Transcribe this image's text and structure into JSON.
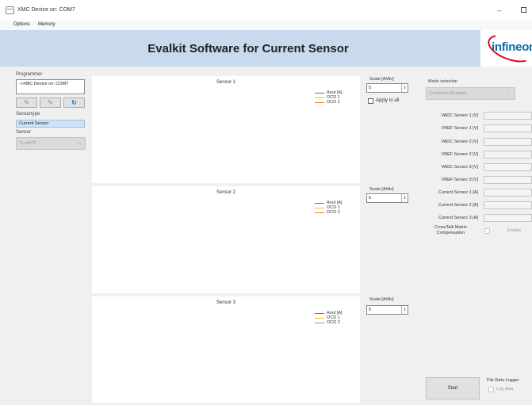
{
  "window": {
    "title": "XMC Device on: COM7",
    "minimize_glyph": "–"
  },
  "menu": {
    "items": [
      "Options",
      "Memory"
    ]
  },
  "banner": {
    "title": "Evalkit Software for Current Sensor",
    "logo_text": "infineon"
  },
  "sidebar": {
    "programmer_label": "Programmer",
    "programmer_value": "->XMC Device on: COM7",
    "tools": {
      "pencil": "✎",
      "pencil_disabled": "✎",
      "refresh": "↻"
    },
    "sensortype_label": "Sensortype",
    "sensortype_item": "Current Sensor",
    "sensor_label": "Sensor",
    "sensor_value": "TLx4973",
    "chevron": "⌄"
  },
  "charts": [
    {
      "title": "Sensor 1",
      "legend": [
        "Aout [A]",
        "OCD 1",
        "OCD 2"
      ]
    },
    {
      "title": "Sensor 2",
      "legend": [
        "Aout [A]",
        "OCD 1",
        "OCD 2"
      ]
    },
    {
      "title": "Sensor 3",
      "legend": [
        "Aout [A]",
        "OCD 1",
        "OCD 2"
      ]
    }
  ],
  "legend_colors": [
    "#4472c4",
    "#ffc000",
    "#ed7d31"
  ],
  "scales": [
    {
      "label": "Scale [A/div]",
      "value": "5"
    },
    {
      "label": "Scale [A/div]",
      "value": "5"
    },
    {
      "label": "Scale [A/div]",
      "value": "5"
    }
  ],
  "spin_glyph": "⇕",
  "apply_to_all": "Apply to all",
  "right_panel": {
    "mode_label": "Mode selection",
    "mode_value": "Continuos Readout",
    "measurements": [
      "VADC Sensor 1  [V]",
      "VREF Sensor 1 [V]",
      "VADC Sensor 2 [V]",
      "VREF Sensor 2 [V]",
      "VADC Sensor 3 [V]",
      "VREF Sensor 3 [V]",
      "Current Sensor 1 [A]",
      "Current Sensor 2 [A]",
      "Current Sensor 3 [A]"
    ],
    "crosstalk_line1": "CrossTalk Matrix",
    "crosstalk_line2": "Compensation",
    "enable_label": "Enable",
    "start_label": "Start",
    "logger_label": "File Data Logger",
    "log_data_label": "Log data"
  }
}
